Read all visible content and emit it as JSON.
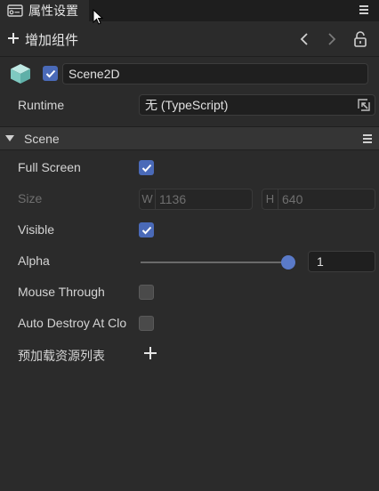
{
  "panel": {
    "tab_title": "属性设置",
    "add_component": "增加组件"
  },
  "node": {
    "name": "Scene2D",
    "enabled": true
  },
  "runtime": {
    "label": "Runtime",
    "value": "无 (TypeScript)"
  },
  "section": {
    "title": "Scene"
  },
  "props": {
    "full_screen": {
      "label": "Full Screen",
      "checked": true
    },
    "size": {
      "label": "Size",
      "w_prefix": "W",
      "w_value": "1136",
      "h_prefix": "H",
      "h_value": "640"
    },
    "visible": {
      "label": "Visible",
      "checked": true
    },
    "alpha": {
      "label": "Alpha",
      "value": "1",
      "level": 1.0
    },
    "mouse_through": {
      "label": "Mouse Through",
      "checked": false
    },
    "auto_destroy": {
      "label": "Auto Destroy At Clo",
      "checked": false
    },
    "preload": {
      "label": "预加载资源列表"
    }
  },
  "colors": {
    "accent": "#4a6ab8",
    "background": "#2b2b2b",
    "field": "#1f1f1f"
  },
  "icons": [
    "properties-icon",
    "panel-menu-icon",
    "plus-icon",
    "arrow-left-icon",
    "arrow-right-icon",
    "unlock-icon",
    "cube-icon",
    "checkmark-icon",
    "select-target-icon",
    "caret-down-icon",
    "section-menu-icon"
  ]
}
